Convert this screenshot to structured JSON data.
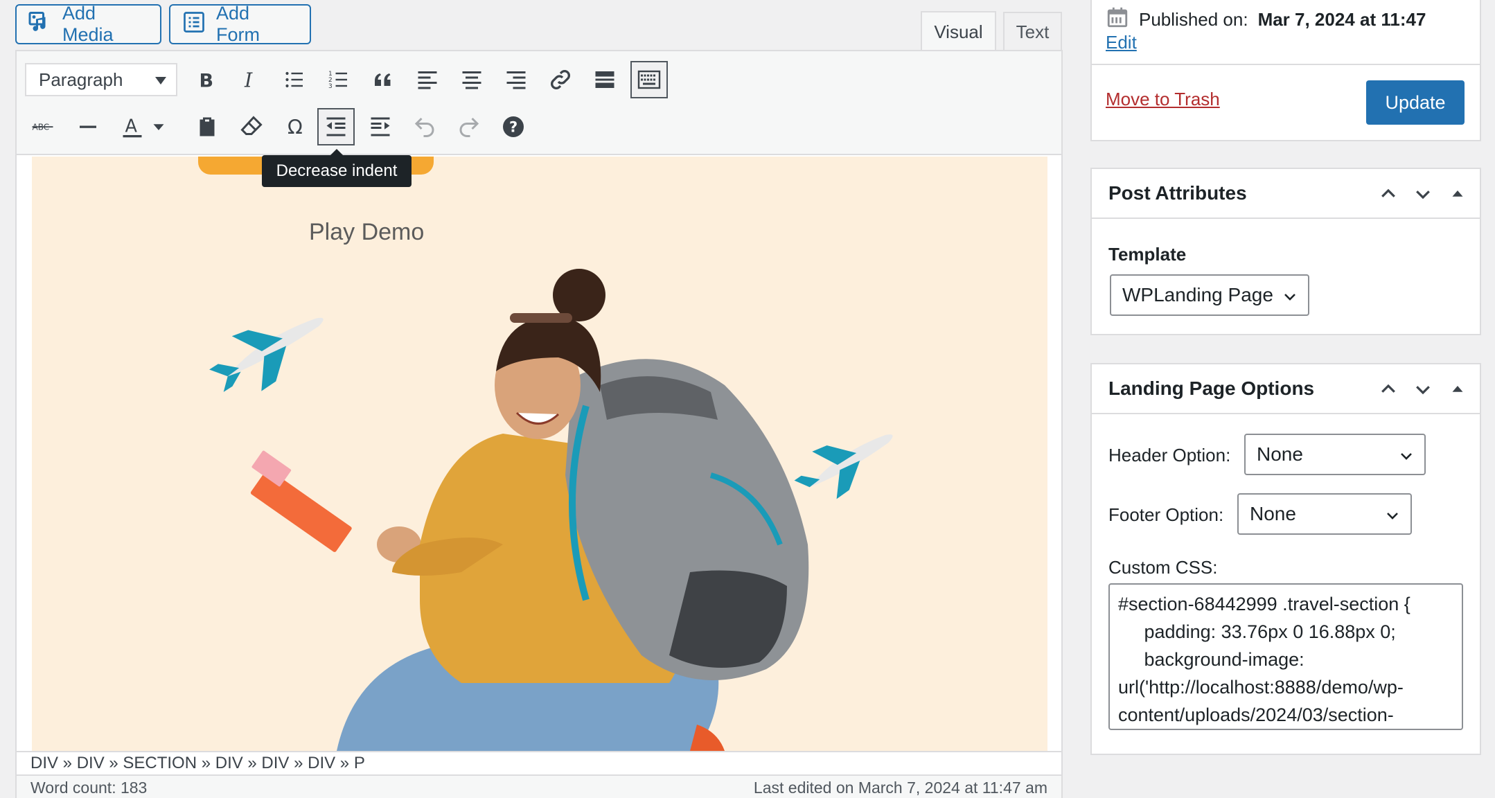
{
  "media_buttons": {
    "add_media": "Add Media",
    "add_form": "Add Form"
  },
  "tabs": {
    "visual": "Visual",
    "text": "Text"
  },
  "toolbar": {
    "format": "Paragraph"
  },
  "tooltip": "Decrease indent",
  "content": {
    "play_demo": "Play Demo"
  },
  "pathbar": "DIV » DIV » SECTION » DIV » DIV » DIV » P",
  "status": {
    "word_count": "Word count: 183",
    "last_edited": "Last edited on March 7, 2024 at 11:47 am"
  },
  "publish": {
    "published_label": "Published on:",
    "published_date": "Mar 7, 2024 at 11:47",
    "edit": "Edit",
    "trash": "Move to Trash",
    "update": "Update"
  },
  "post_attributes": {
    "title": "Post Attributes",
    "template_label": "Template",
    "template_value": "WPLanding Page"
  },
  "landing_options": {
    "title": "Landing Page Options",
    "header_label": "Header Option:",
    "header_value": "None",
    "footer_label": "Footer Option:",
    "footer_value": "None",
    "css_label": "Custom CSS:",
    "css_value": "#section-68442999 .travel-section {\n     padding: 33.76px 0 16.88px 0;\n     background-image:\nurl('http://localhost:8888/demo/wp-\ncontent/uploads/2024/03/section-"
  },
  "colors": {
    "accent": "#2271b1",
    "trash": "#b32d2e",
    "content_bg": "#fdefdc",
    "orange": "#f5a832",
    "teal": "#1a9bb8"
  }
}
